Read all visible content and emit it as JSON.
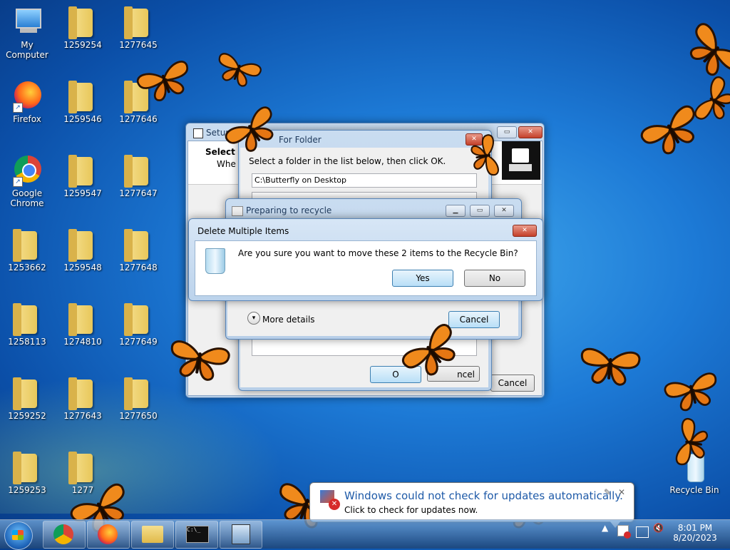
{
  "desktop_icons": [
    {
      "label": "My Computer",
      "type": "computer"
    },
    {
      "label": "Firefox",
      "type": "firefox"
    },
    {
      "label": "Google Chrome",
      "type": "chrome"
    },
    {
      "label": "1253662",
      "type": "folder"
    },
    {
      "label": "1258113",
      "type": "folder"
    },
    {
      "label": "1259252",
      "type": "folder"
    },
    {
      "label": "1259253",
      "type": "folder"
    },
    {
      "label": "1259254",
      "type": "folder"
    },
    {
      "label": "1259546",
      "type": "folder"
    },
    {
      "label": "1259547",
      "type": "folder"
    },
    {
      "label": "1259548",
      "type": "folder"
    },
    {
      "label": "1274810",
      "type": "folder"
    },
    {
      "label": "1277643",
      "type": "folder"
    },
    {
      "label": "1277",
      "type": "folder"
    },
    {
      "label": "1277645",
      "type": "folder"
    },
    {
      "label": "1277646",
      "type": "folder"
    },
    {
      "label": "1277647",
      "type": "folder"
    },
    {
      "label": "1277648",
      "type": "folder"
    },
    {
      "label": "1277649",
      "type": "folder"
    },
    {
      "label": "1277650",
      "type": "folder"
    },
    {
      "label": "Recycle Bin",
      "type": "recycle-bin"
    }
  ],
  "setup_window": {
    "title": "Setup - B",
    "heading": "Select",
    "subheading": "Whe",
    "cancel_label": "Cancel"
  },
  "browse_dialog": {
    "title": "For Folder",
    "instruction": "Select a folder in the list below, then click OK.",
    "path_value": "C:\\Butterfly on Desktop",
    "ok_label": "O",
    "cancel_label": "ncel"
  },
  "recycle_progress": {
    "title": "Preparing to recycle",
    "more_details_label": "More details",
    "cancel_label": "Cancel"
  },
  "delete_dialog": {
    "title": "Delete Multiple Items",
    "message": "Are you sure you want to move these 2 items to the Recycle Bin?",
    "yes_label": "Yes",
    "no_label": "No"
  },
  "notification": {
    "title": "Windows could not check for updates automatically.",
    "body": "Click to check for updates now."
  },
  "taskbar": {
    "time": "8:01 PM",
    "date": "8/20/2023",
    "pinned": [
      "chrome-icon",
      "firefox-icon",
      "explorer-icon",
      "cmd-icon",
      "setup-icon"
    ]
  },
  "colors": {
    "desktop": "#1d7ad6",
    "butterfly": "#f08a1c",
    "title_text": "#1e395b",
    "notification_title": "#1e5aa8"
  }
}
